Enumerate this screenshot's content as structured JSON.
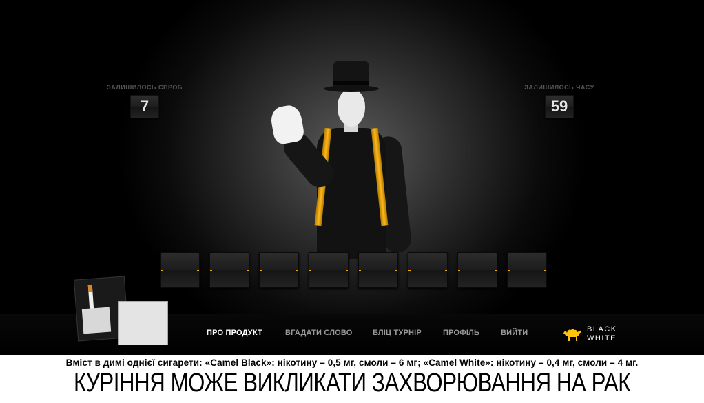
{
  "counters": {
    "attempts": {
      "label": "ЗАЛИШИЛОСЬ СПРОБ",
      "value": "7"
    },
    "time": {
      "label": "ЗАЛИШИЛОСЬ ЧАСУ",
      "value": "59"
    }
  },
  "word_tiles": {
    "count": 8,
    "letters": [
      "",
      "",
      "",
      "",
      "",
      "",
      "",
      ""
    ]
  },
  "nav": {
    "items": [
      {
        "label": "ПРО ПРОДУКТ",
        "active": true
      },
      {
        "label": "ВГАДАТИ СЛОВО",
        "active": false
      },
      {
        "label": "БЛІЦ ТУРНІР",
        "active": false
      },
      {
        "label": "ПРОФІЛЬ",
        "active": false
      },
      {
        "label": "ВИЙТИ",
        "active": false
      }
    ]
  },
  "brand": {
    "line1": "BLACK",
    "line2": "WHITE",
    "icon": "camel-icon",
    "color": "#ffc20e"
  },
  "accent_color": "#ffa500",
  "warning": {
    "content_text": "Вміст в димі однієї сигарети: «Camel Black»: нікотину – 0,5 мг, смоли – 6 мг; «Camel White»: нікотину – 0,4 мг, смоли – 4 мг.",
    "headline": "КУРІННЯ МОЖЕ ВИКЛИКАТИ ЗАХВОРЮВАННЯ НА РАК"
  }
}
